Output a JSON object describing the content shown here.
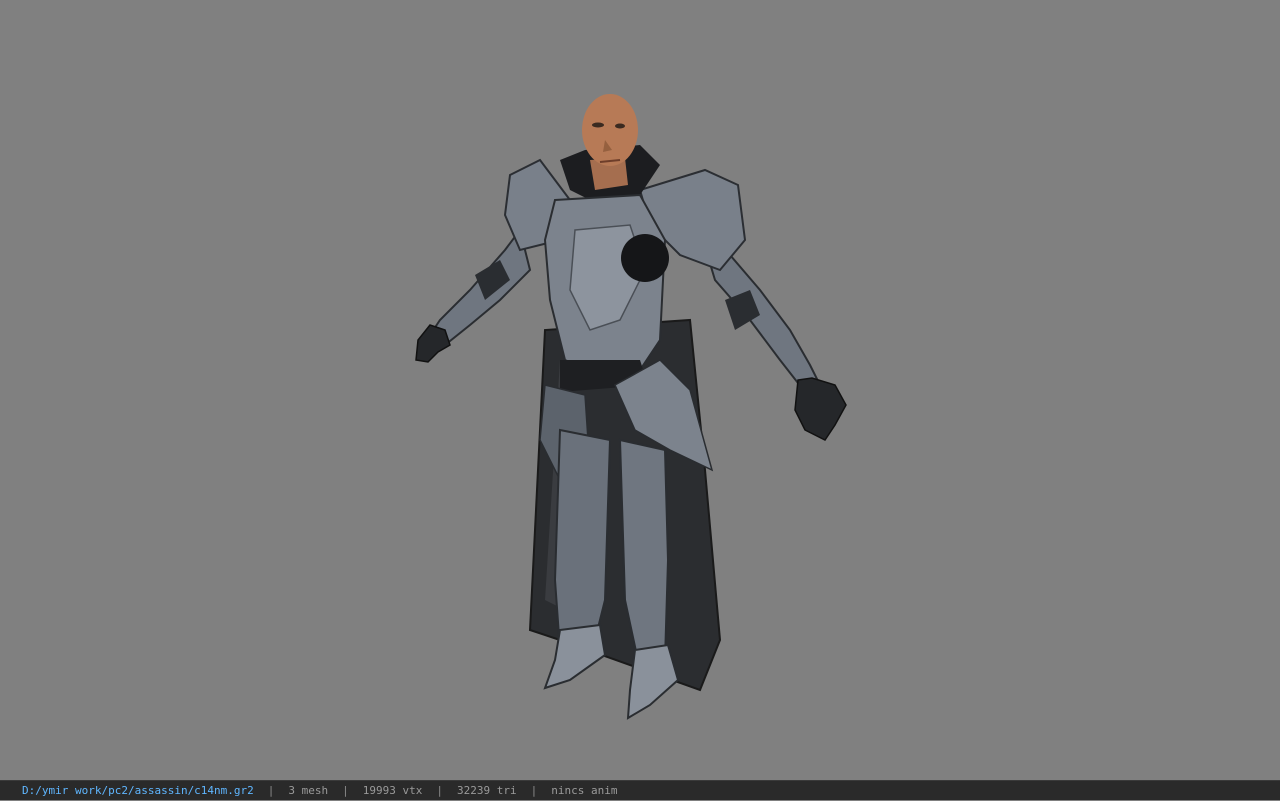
{
  "viewer": {
    "background_color": "#808080",
    "model_subject": "armored assassin character in T-pose"
  },
  "statusbar": {
    "file_path": "D:/ymir work/pc2/assassin/c14nm.gr2",
    "mesh_count": "3 mesh",
    "vertex_count": "19993 vtx",
    "triangle_count": "32239 tri",
    "anim_state": "nincs anim",
    "separator": "|"
  }
}
